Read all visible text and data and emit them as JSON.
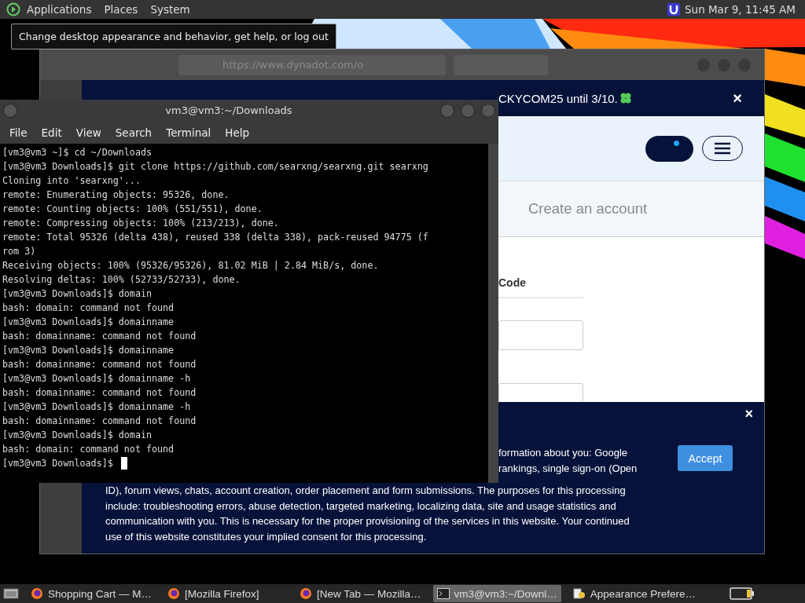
{
  "top_panel": {
    "menus": [
      "Applications",
      "Places",
      "System"
    ],
    "clock": "Sun Mar 9, 11:45 AM"
  },
  "tooltip": "Change desktop appearance and behavior, get help, or log out",
  "browser": {
    "url": "https://www.dynadot.com/o",
    "banner": "CKYCOM25 until 3/10.",
    "banner_close": "×",
    "create_account": "Create an account",
    "form_label": "Code",
    "cookie": {
      "partial_lines": [
        "formation about you: Google",
        "rankings, single sign-on (Open"
      ],
      "paragraph": "ID), forum views, chats, account creation, order placement and form submissions. The purposes for this processing include: troubleshooting errors, abuse detection, targeted marketing, localizing data, site and usage statistics and communication with you. This is necessary for the proper provisioning of the services in this website. Your continued use of this website constitutes your implied consent for this processing.",
      "accept": "Accept",
      "close": "×"
    }
  },
  "terminal": {
    "title": "vm3@vm3:~/Downloads",
    "menu": [
      "File",
      "Edit",
      "View",
      "Search",
      "Terminal",
      "Help"
    ],
    "lines": [
      "[vm3@vm3 ~]$ cd ~/Downloads",
      "[vm3@vm3 Downloads]$ git clone https://github.com/searxng/searxng.git searxng",
      "Cloning into 'searxng'...",
      "remote: Enumerating objects: 95326, done.",
      "remote: Counting objects: 100% (551/551), done.",
      "remote: Compressing objects: 100% (213/213), done.",
      "remote: Total 95326 (delta 438), reused 338 (delta 338), pack-reused 94775 (f",
      "rom 3)",
      "Receiving objects: 100% (95326/95326), 81.02 MiB | 2.84 MiB/s, done.",
      "Resolving deltas: 100% (52733/52733), done.",
      "[vm3@vm3 Downloads]$ domain",
      "bash: domain: command not found",
      "[vm3@vm3 Downloads]$ domainname",
      "bash: domainname: command not found",
      "[vm3@vm3 Downloads]$ domainname",
      "bash: domainname: command not found",
      "[vm3@vm3 Downloads]$ domainname -h",
      "bash: domainname: command not found",
      "[vm3@vm3 Downloads]$ domainname -h",
      "bash: domainname: command not found",
      "[vm3@vm3 Downloads]$ domain",
      "bash: domain: command not found"
    ],
    "prompt": "[vm3@vm3 Downloads]$"
  },
  "taskbar": [
    {
      "kind": "firefox",
      "label": "Shopping Cart — M…",
      "selected": false
    },
    {
      "kind": "firefox",
      "label": "[Mozilla Firefox]",
      "selected": false
    },
    {
      "kind": "firefox",
      "label": "[New Tab — Mozilla…",
      "selected": false
    },
    {
      "kind": "terminal",
      "label": "vm3@vm3:~/Downl…",
      "selected": true
    },
    {
      "kind": "appearance",
      "label": "Appearance Prefere…",
      "selected": false
    }
  ]
}
